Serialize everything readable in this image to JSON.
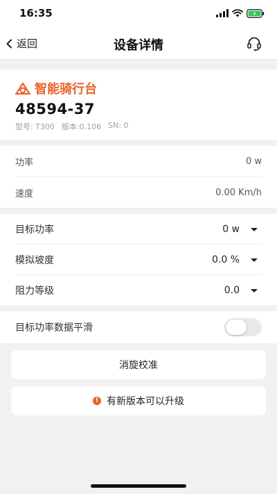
{
  "status_bar": {
    "time": "16:35"
  },
  "nav": {
    "back_label": "返回",
    "title": "设备详情"
  },
  "device": {
    "brand_name": "智能骑行台",
    "id": "48594-37",
    "model": "型号: T300",
    "version": "版本:0.106",
    "sn": "SN: 0"
  },
  "readings": [
    {
      "label": "功率",
      "value": "0 w"
    },
    {
      "label": "速度",
      "value": "0.00 Km/h"
    }
  ],
  "controls": [
    {
      "label": "目标功率",
      "value": "0 w"
    },
    {
      "label": "模拟坡度",
      "value": "0.0 %"
    },
    {
      "label": "阻力等级",
      "value": "0.0"
    }
  ],
  "smoothing": {
    "label": "目标功率数据平滑",
    "enabled": false
  },
  "buttons": {
    "calibrate": "消旋校准",
    "upgrade": "有新版本可以升级",
    "upgrade_badge": "!"
  },
  "colors": {
    "accent": "#e8622a",
    "background": "#f1f1f4"
  }
}
